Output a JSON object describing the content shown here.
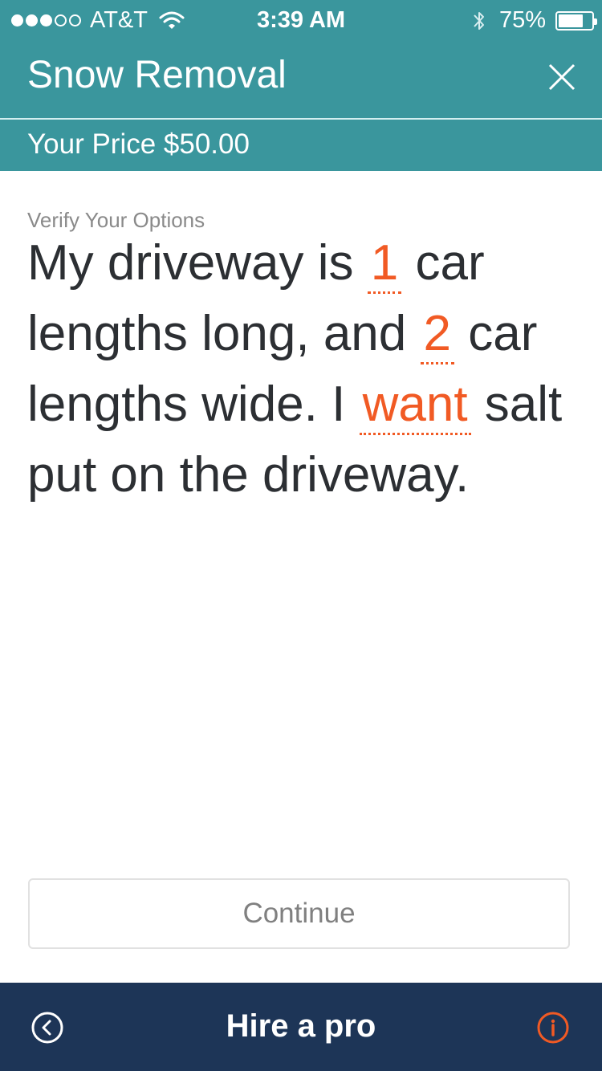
{
  "status_bar": {
    "signal_filled": 3,
    "signal_total": 5,
    "carrier": "AT&T",
    "time": "3:39 AM",
    "battery_percent_text": "75%",
    "battery_level": 0.75,
    "icons": [
      "wifi-icon",
      "bluetooth-icon",
      "battery-icon"
    ]
  },
  "header": {
    "title": "Snow Removal",
    "close_icon": "close-icon"
  },
  "price_bar": {
    "text": "Your Price $50.00"
  },
  "options": {
    "label": "Verify Your Options",
    "sentence": {
      "part1": "My driveway is ",
      "length_value": "1",
      "part2": " car lengths long, and ",
      "width_value": "2",
      "part3": " car lengths wide. I ",
      "salt_value": "want",
      "part4": " salt put on the driveway."
    }
  },
  "continue_button": {
    "label": "Continue"
  },
  "bottom_bar": {
    "title": "Hire a pro",
    "back_icon": "back-circle-icon",
    "info_icon": "info-circle-icon"
  },
  "colors": {
    "teal": "#3a969d",
    "accent_orange": "#f15a24",
    "navy": "#1d3557",
    "text_dark": "#2c2f33"
  }
}
